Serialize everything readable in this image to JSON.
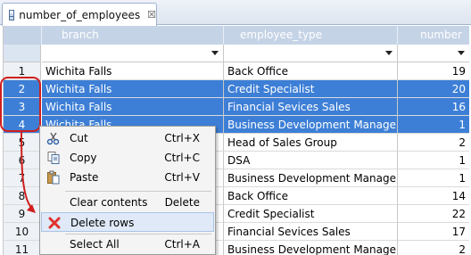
{
  "tab": {
    "title": "number_of_employees",
    "close_glyph": "☒"
  },
  "columns": [
    "branch",
    "employee_type",
    "number"
  ],
  "rows": [
    {
      "n": "1",
      "branch": "Wichita Falls",
      "type": "Back Office",
      "number": "19"
    },
    {
      "n": "2",
      "branch": "Wichita Falls",
      "type": "Credit Specialist",
      "number": "20"
    },
    {
      "n": "3",
      "branch": "Wichita Falls",
      "type": "Financial Sevices Sales",
      "number": "16"
    },
    {
      "n": "4",
      "branch": "Wichita Falls",
      "type": "Business Development Manager",
      "number": "1"
    },
    {
      "n": "5",
      "branch": "",
      "type": "Head of Sales Group",
      "number": "2"
    },
    {
      "n": "6",
      "branch": "",
      "type": "DSA",
      "number": "1"
    },
    {
      "n": "7",
      "branch": "",
      "type": "Business Development Manager",
      "number": "1"
    },
    {
      "n": "8",
      "branch": "",
      "type": "Back Office",
      "number": "14"
    },
    {
      "n": "9",
      "branch": "",
      "type": "Credit Specialist",
      "number": "22"
    },
    {
      "n": "10",
      "branch": "",
      "type": "Financial Sevices Sales",
      "number": "17"
    },
    {
      "n": "11",
      "branch": "",
      "type": "Business Development Manager",
      "number": "2"
    }
  ],
  "selected_rows": [
    "2",
    "3",
    "4"
  ],
  "context_menu": {
    "cut": {
      "label": "Cut",
      "shortcut": "Ctrl+X",
      "icon": "scissors-icon"
    },
    "copy": {
      "label": "Copy",
      "shortcut": "Ctrl+C",
      "icon": "copy-icon"
    },
    "paste": {
      "label": "Paste",
      "shortcut": "Ctrl+V",
      "icon": "paste-icon"
    },
    "clear": {
      "label": "Clear contents",
      "shortcut": "Delete"
    },
    "delete_rows": {
      "label": "Delete rows",
      "icon": "delete-x-icon"
    },
    "select_all": {
      "label": "Select All",
      "shortcut": "Ctrl+A"
    }
  },
  "colors": {
    "selection": "#3d7fd6",
    "header": "#c5d3e6",
    "callout": "#d01f1f",
    "delete_icon": "#e0322d"
  }
}
